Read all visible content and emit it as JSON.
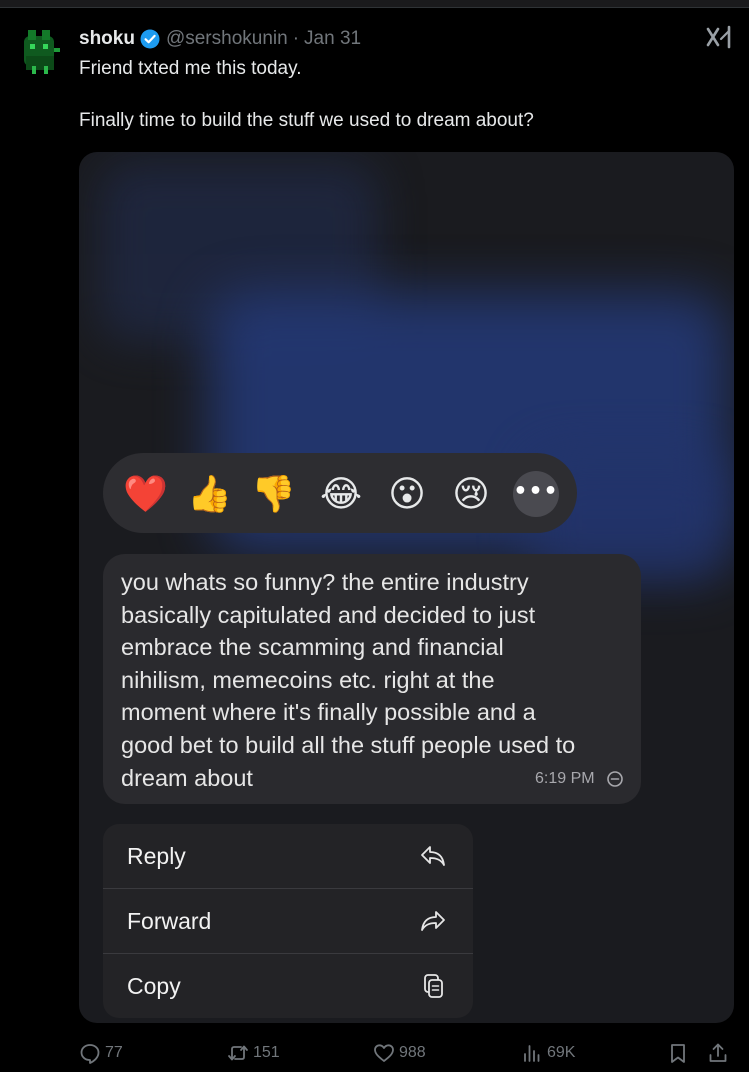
{
  "post": {
    "display_name": "shoku",
    "handle": "@sershokunin",
    "separator": "·",
    "date": "Jan 31",
    "text_line1": "Friend txted me this today.",
    "text_line2": "Finally time to build the stuff we used to dream about?"
  },
  "screenshot": {
    "reactions": [
      "❤️",
      "👍",
      "👎",
      "😂",
      "😮",
      "😢"
    ],
    "more_label": "•••",
    "message_lines": [
      "you whats so funny? the entire industry",
      "basically capitulated and decided to just",
      "embrace the scamming and financial",
      "nihilism, memecoins etc. right at the",
      "moment where it's finally possible and a",
      "good bet to build all the stuff people used to",
      "dream about"
    ],
    "message_time": "6:19 PM",
    "menu": [
      {
        "label": "Reply",
        "icon": "reply-arrow-icon"
      },
      {
        "label": "Forward",
        "icon": "forward-arrow-icon"
      },
      {
        "label": "Copy",
        "icon": "copy-icon"
      }
    ]
  },
  "actions": {
    "replies": "77",
    "reposts": "151",
    "likes": "988",
    "views": "69K"
  },
  "colors": {
    "background": "#000000",
    "verified_badge": "#1d9bf0",
    "muted_text": "#71767b",
    "bubble": "#2a2a2e"
  }
}
